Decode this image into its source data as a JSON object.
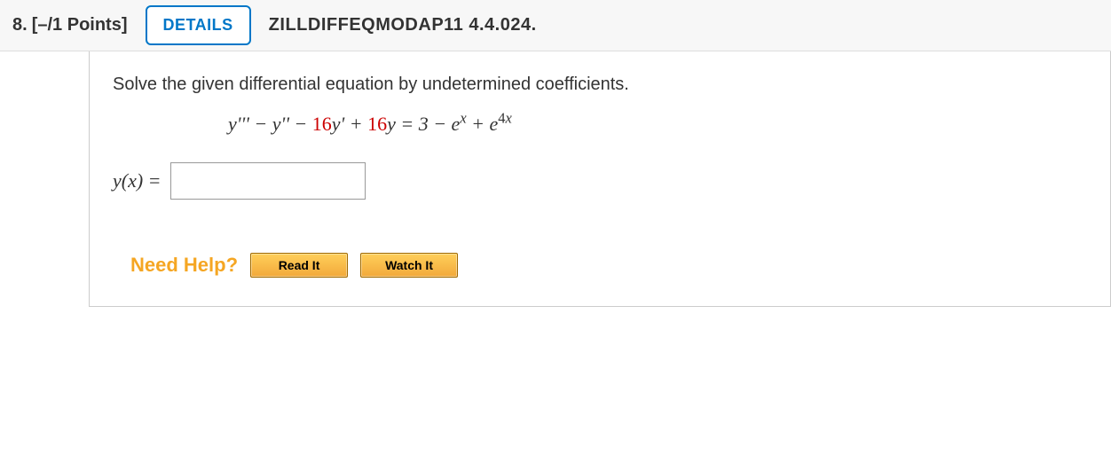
{
  "header": {
    "number": "8.",
    "points": "[–/1 Points]",
    "details_label": "DETAILS",
    "reference": "ZILLDIFFEQMODAP11 4.4.024."
  },
  "body": {
    "prompt": "Solve the given differential equation by undetermined coefficients.",
    "equation": {
      "lhs_pre": "y''' − y'' − ",
      "lhs_red1": "16",
      "lhs_mid": "y' + ",
      "lhs_red2": "16",
      "lhs_post": "y = 3 − e",
      "sup1": "x",
      "plus": " + e",
      "sup2_num": "4",
      "sup2_var": "x"
    },
    "answer_label": "y(x) =",
    "answer_value": ""
  },
  "help": {
    "label": "Need Help?",
    "read": "Read It",
    "watch": "Watch It"
  }
}
